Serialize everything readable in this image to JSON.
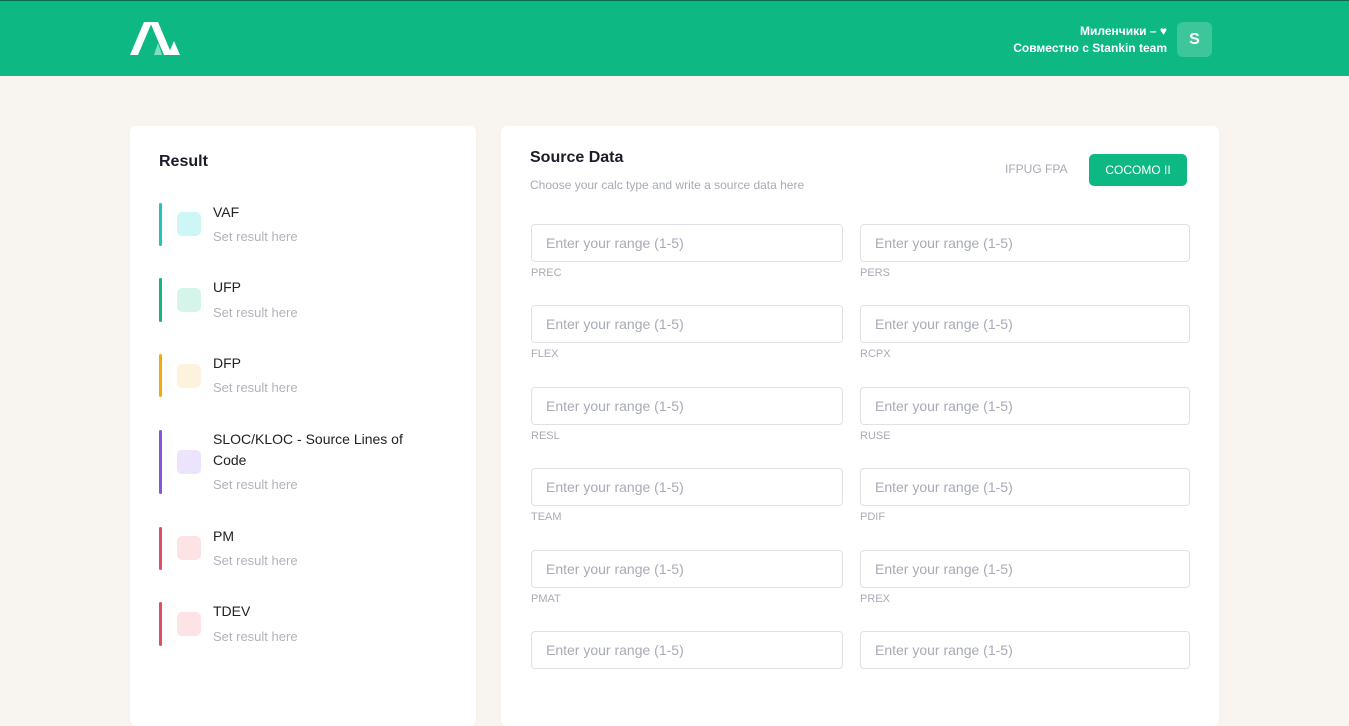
{
  "header": {
    "user_line1": "Миленчики – ♥",
    "user_line2": "Совместно с Stankin team",
    "avatar_initial": "S"
  },
  "result": {
    "title": "Result",
    "items": [
      {
        "name": "VAF",
        "value": "Set result here",
        "bar_color": "#21c3bd",
        "swatch_color": "#cff6f6"
      },
      {
        "name": "UFP",
        "value": "Set result here",
        "bar_color": "#14b67e",
        "swatch_color": "#d6f5ea"
      },
      {
        "name": "DFP",
        "value": "Set result here",
        "bar_color": "#f5ab10",
        "swatch_color": "#fdf2de"
      },
      {
        "name": "SLOC/KLOC - Source Lines of Code",
        "value": "Set result here",
        "bar_color": "#8653e0",
        "swatch_color": "#ece4fc"
      },
      {
        "name": "PM",
        "value": "Set result here",
        "bar_color": "#e24d66",
        "swatch_color": "#fde2e6"
      },
      {
        "name": "TDEV",
        "value": "Set result here",
        "bar_color": "#e24d66",
        "swatch_color": "#fde2e6"
      }
    ]
  },
  "source": {
    "title": "Source Data",
    "subtitle": "Choose your calc type and write a source data here",
    "tab_ifpug": "IFPUG FPA",
    "tab_cocomo": "COCOMO II",
    "placeholder": "Enter your range (1-5)",
    "fields": [
      {
        "left": "PREC",
        "right": "PERS"
      },
      {
        "left": "FLEX",
        "right": "RCPX"
      },
      {
        "left": "RESL",
        "right": "RUSE"
      },
      {
        "left": "TEAM",
        "right": "PDIF"
      },
      {
        "left": "PMAT",
        "right": "PREX"
      },
      {
        "left": "",
        "right": ""
      }
    ]
  },
  "colors": {
    "accent": "#0eb883",
    "background": "#f8f4ef"
  }
}
